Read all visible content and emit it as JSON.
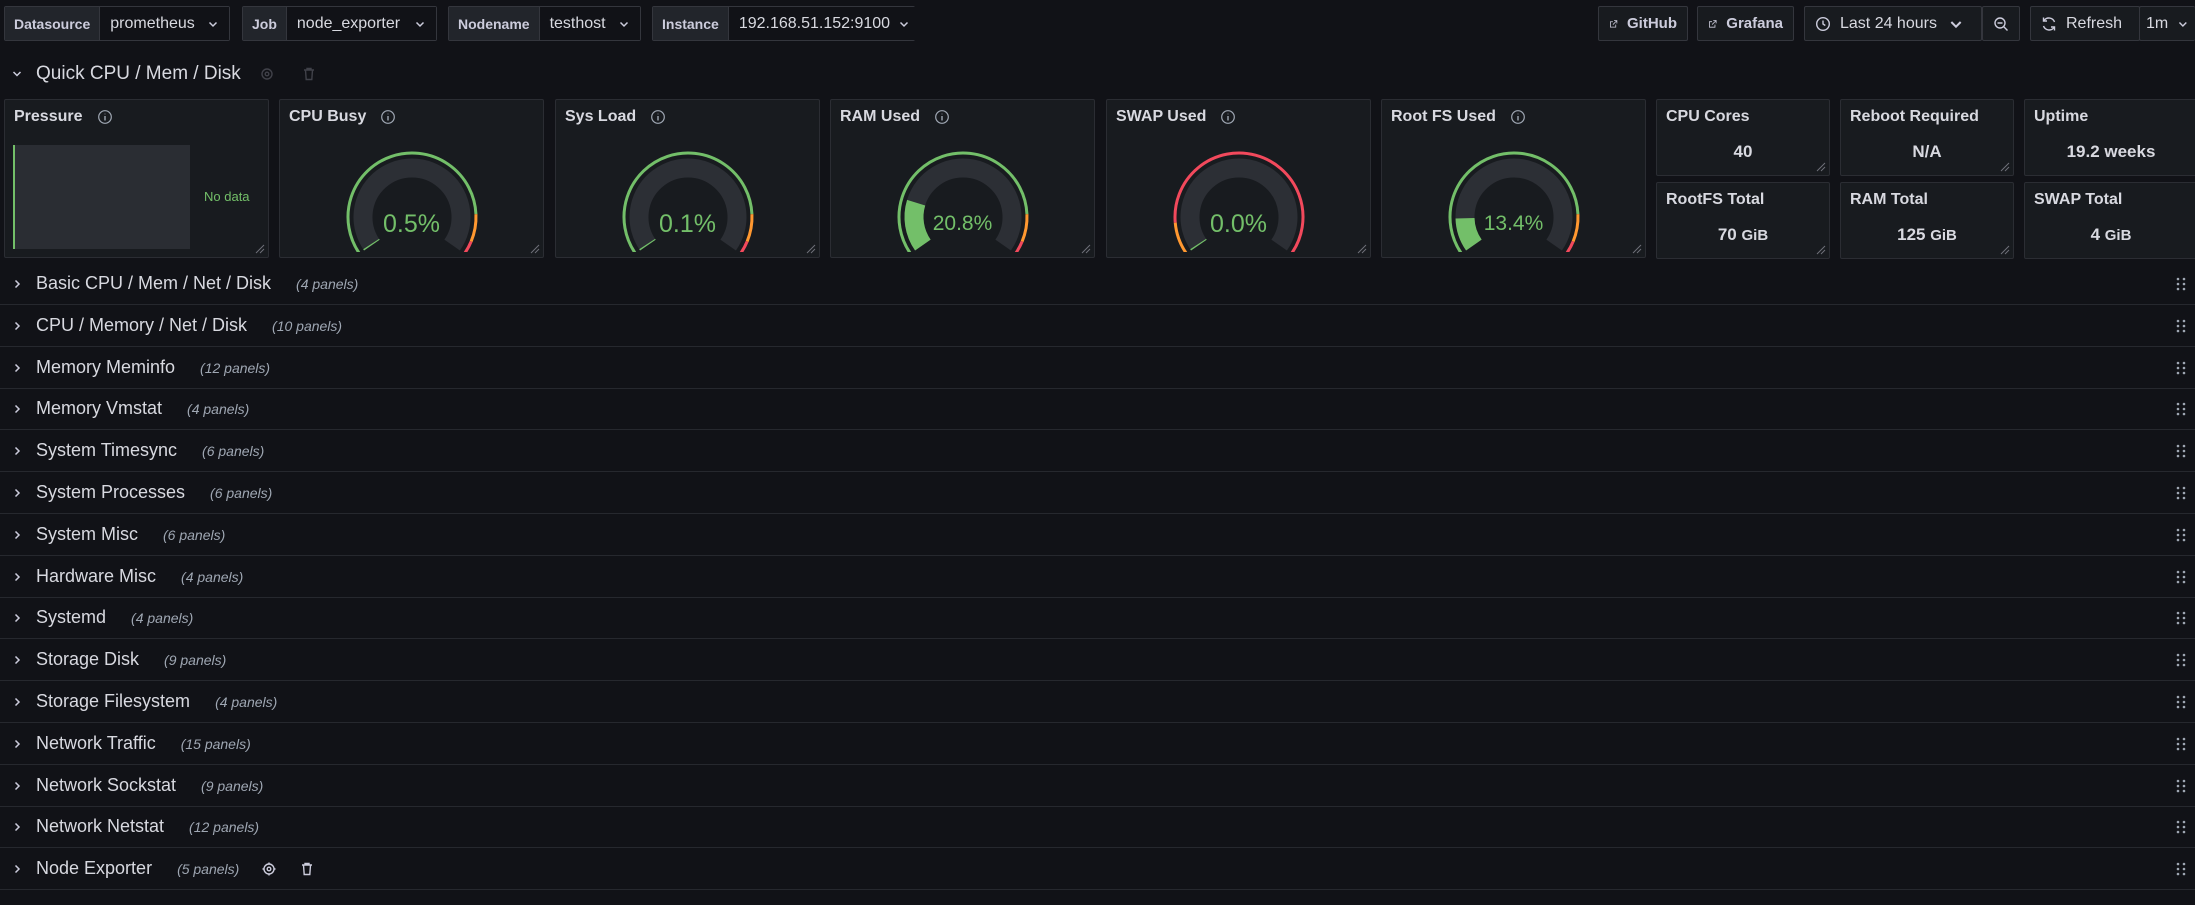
{
  "variables": [
    {
      "label": "Datasource",
      "value": "prometheus"
    },
    {
      "label": "Job",
      "value": "node_exporter"
    },
    {
      "label": "Nodename",
      "value": "testhost"
    },
    {
      "label": "Instance",
      "value": "192.168.51.152:9100"
    }
  ],
  "toolbar": {
    "github_label": "GitHub",
    "grafana_label": "Grafana",
    "time_range": "Last 24 hours",
    "refresh_label": "Refresh",
    "refresh_interval": "1m"
  },
  "quick_row": {
    "title": "Quick CPU / Mem / Disk",
    "panels": {
      "pressure": {
        "title": "Pressure",
        "no_data": "No data"
      },
      "gauges": [
        {
          "title": "CPU Busy",
          "value": "0.5%",
          "percent": 0.5
        },
        {
          "title": "Sys Load",
          "value": "0.1%",
          "percent": 0.1
        },
        {
          "title": "RAM Used",
          "value": "20.8%",
          "percent": 20.8
        },
        {
          "title": "SWAP Used",
          "value": "0.0%",
          "percent": 0.0
        },
        {
          "title": "Root FS Used",
          "value": "13.4%",
          "percent": 13.4
        }
      ],
      "stats": [
        {
          "title": "CPU Cores",
          "value": "40",
          "unit": ""
        },
        {
          "title": "Reboot Required",
          "value": "N/A",
          "unit": ""
        },
        {
          "title": "Uptime",
          "value": "19.2 weeks",
          "unit": ""
        },
        {
          "title": "RootFS Total",
          "value": "70",
          "unit": "GiB"
        },
        {
          "title": "RAM Total",
          "value": "125",
          "unit": "GiB"
        },
        {
          "title": "SWAP Total",
          "value": "4",
          "unit": "GiB"
        }
      ]
    }
  },
  "rows": [
    {
      "title": "Basic CPU / Mem / Net / Disk",
      "count": "(4 panels)"
    },
    {
      "title": "CPU / Memory / Net / Disk",
      "count": "(10 panels)"
    },
    {
      "title": "Memory Meminfo",
      "count": "(12 panels)"
    },
    {
      "title": "Memory Vmstat",
      "count": "(4 panels)"
    },
    {
      "title": "System Timesync",
      "count": "(6 panels)"
    },
    {
      "title": "System Processes",
      "count": "(6 panels)"
    },
    {
      "title": "System Misc",
      "count": "(6 panels)"
    },
    {
      "title": "Hardware Misc",
      "count": "(4 panels)"
    },
    {
      "title": "Systemd",
      "count": "(4 panels)"
    },
    {
      "title": "Storage Disk",
      "count": "(9 panels)"
    },
    {
      "title": "Storage Filesystem",
      "count": "(4 panels)"
    },
    {
      "title": "Network Traffic",
      "count": "(15 panels)"
    },
    {
      "title": "Network Sockstat",
      "count": "(9 panels)"
    },
    {
      "title": "Network Netstat",
      "count": "(12 panels)"
    },
    {
      "title": "Node Exporter",
      "count": "(5 panels)"
    }
  ],
  "colors": {
    "ok": "#73bf69",
    "warn": "#ff9830",
    "crit": "#f2495c",
    "track": "#2c2f35"
  }
}
